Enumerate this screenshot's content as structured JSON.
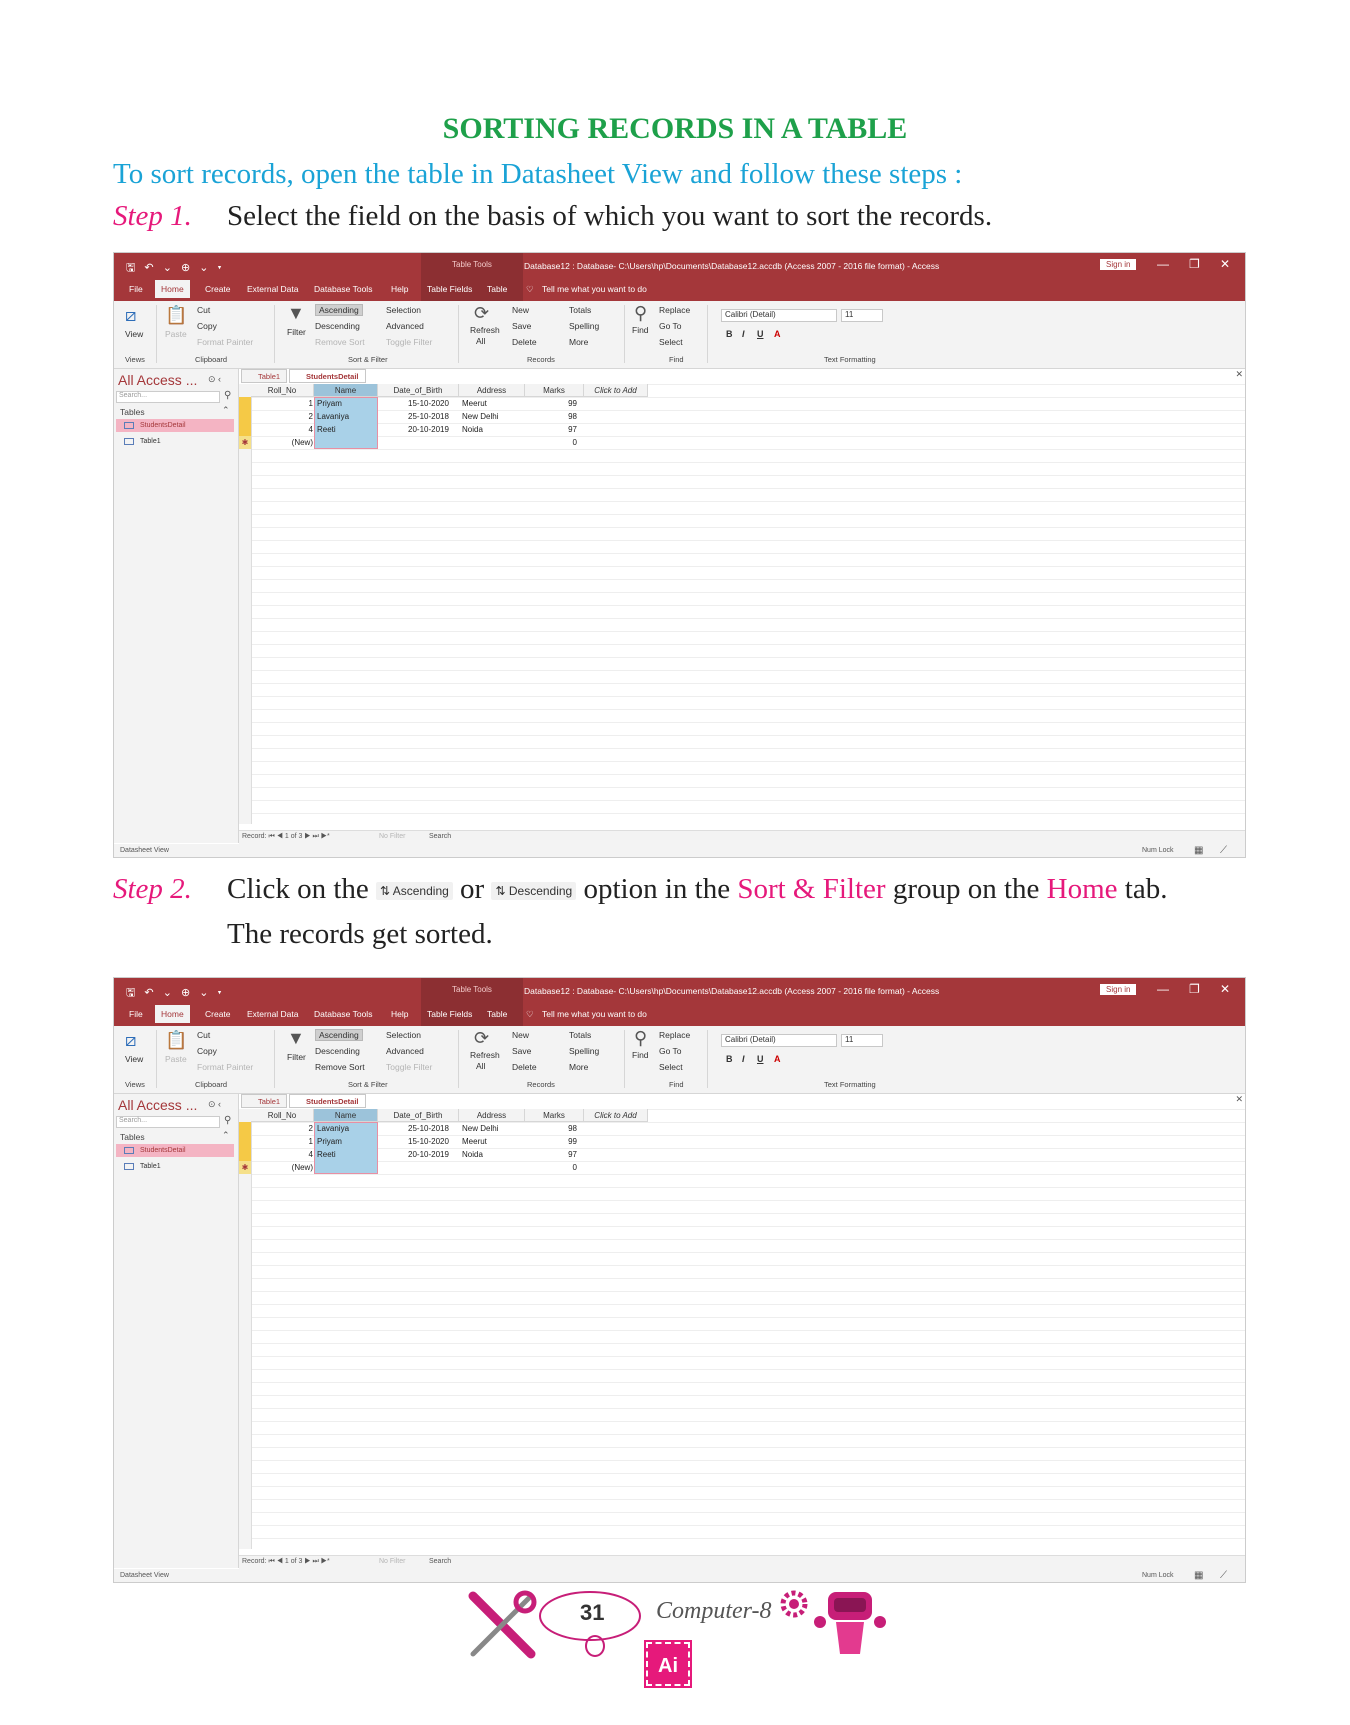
{
  "heading": "SORTING RECORDS IN A TABLE",
  "intro": "To sort records, open the table in Datasheet View and follow these steps :",
  "step1": {
    "label": "Step 1.",
    "text": "Select the field on the basis of which you want to sort the records."
  },
  "step2": {
    "label": "Step 2.",
    "part1": "Click on the",
    "ascending_btn": "Ascending",
    "or": "or",
    "descending_btn": "Descending",
    "part2": "option in the",
    "group": "Sort & Filter",
    "part3": "group on the",
    "tab": "Home",
    "part4": "tab.",
    "line2": "The records get sorted."
  },
  "access": {
    "qat": "🖫 ↶ ⌄ ⊕ ⌄ ▾",
    "table_tools": "Table Tools",
    "title": "Database12 : Database- C:\\Users\\hp\\Documents\\Database12.accdb (Access 2007 - 2016 file format)  -  Access",
    "sign_in": "Sign in",
    "tabs": [
      "File",
      "Home",
      "Create",
      "External Data",
      "Database Tools",
      "Help",
      "Table Fields",
      "Table"
    ],
    "tell_me": "Tell me what you want to do",
    "ribbon": {
      "view": "View",
      "paste": "Paste",
      "cut": "Cut",
      "copy": "Copy",
      "format_painter": "Format Painter",
      "filter": "Filter",
      "ascending": "Ascending",
      "descending": "Descending",
      "remove_sort": "Remove Sort",
      "selection": "Selection",
      "advanced": "Advanced",
      "toggle_filter": "Toggle Filter",
      "refresh": "Refresh",
      "all": "All",
      "new": "New",
      "save": "Save",
      "delete": "Delete",
      "totals": "Totals",
      "spelling": "Spelling",
      "more": "More",
      "find": "Find",
      "replace": "Replace",
      "go_to": "Go To",
      "select": "Select",
      "font": "Calibri (Detail)",
      "size": "11",
      "bold": "B",
      "italic": "I",
      "underline": "U",
      "groups": [
        "Views",
        "Clipboard",
        "Sort & Filter",
        "Records",
        "Find",
        "Text Formatting"
      ]
    },
    "nav": {
      "title": "All Access ...",
      "search": "Search...",
      "section": "Tables",
      "items": [
        "StudentsDetail",
        "Table1"
      ]
    },
    "doc_tabs": [
      "Table1",
      "StudentsDetail"
    ],
    "columns": [
      "Roll_No",
      "Name",
      "Date_of_Birth",
      "Address",
      "Marks",
      "Click to Add"
    ],
    "new_row": "(New)",
    "new_marks": "0",
    "record_nav": "Record: ⏮ ◀ 1 of 3 ▶ ⏭ ▶*",
    "no_filter": "No Filter",
    "search_label": "Search",
    "status_left": "Datasheet View",
    "status_right": "Num Lock"
  },
  "table_unsorted": [
    {
      "roll": "1",
      "name": "Priyam",
      "dob": "15-10-2020",
      "address": "Meerut",
      "marks": "99"
    },
    {
      "roll": "2",
      "name": "Lavaniya",
      "dob": "25-10-2018",
      "address": "New Delhi",
      "marks": "98"
    },
    {
      "roll": "4",
      "name": "Reeti",
      "dob": "20-10-2019",
      "address": "Noida",
      "marks": "97"
    }
  ],
  "table_sorted": [
    {
      "roll": "2",
      "name": "Lavaniya",
      "dob": "25-10-2018",
      "address": "New Delhi",
      "marks": "98"
    },
    {
      "roll": "1",
      "name": "Priyam",
      "dob": "15-10-2020",
      "address": "Meerut",
      "marks": "99"
    },
    {
      "roll": "4",
      "name": "Reeti",
      "dob": "20-10-2019",
      "address": "Noida",
      "marks": "97"
    }
  ],
  "footer": {
    "page": "31",
    "book": "Computer-8",
    "badge": "Ai"
  },
  "colors": {
    "access_red": "#a4373a",
    "heading_green": "#1ea04a",
    "intro_blue": "#1aa3d6",
    "step_pink": "#e6197b"
  }
}
